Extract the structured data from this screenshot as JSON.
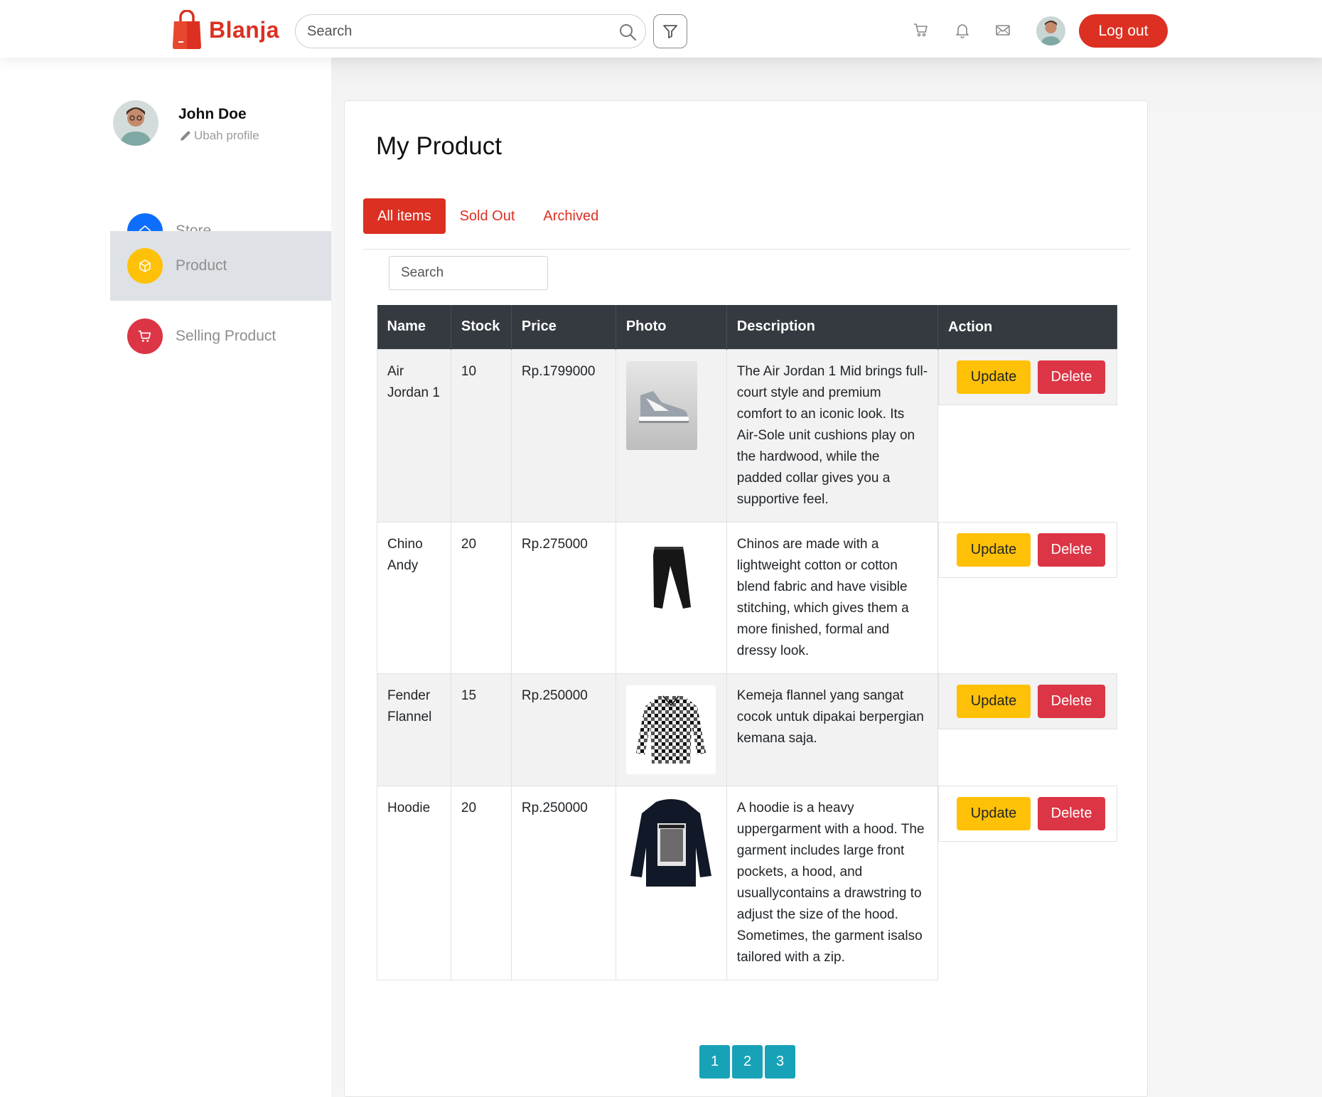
{
  "header": {
    "brand": "Blanja",
    "search_placeholder": "Search",
    "logout_label": "Log out"
  },
  "icons": {
    "search": "search-icon",
    "filter": "filter-icon",
    "cart": "cart-icon",
    "notifications": "bell-icon",
    "messages": "mail-icon"
  },
  "colors": {
    "brand": "#DB3022",
    "update": "#FFC107",
    "delete": "#DC3545",
    "pagination": "#17a2b8",
    "table_header": "#343a40",
    "store_icon_bg": "#0d6efd",
    "product_icon_bg": "#FFC107",
    "selling_icon_bg": "#DC3545"
  },
  "sidebar": {
    "name": "John Doe",
    "edit_label": "Ubah profile",
    "items": [
      {
        "label": "Store",
        "icon": "home-icon"
      },
      {
        "label": "Product",
        "icon": "box-icon",
        "active": true
      },
      {
        "label": "Selling Product",
        "icon": "cart-icon"
      }
    ]
  },
  "main": {
    "title": "My Product",
    "tabs": [
      {
        "label": "All items",
        "active": true
      },
      {
        "label": "Sold Out"
      },
      {
        "label": "Archived"
      }
    ],
    "search_placeholder": "Search",
    "table": {
      "columns": [
        "Name",
        "Stock",
        "Price",
        "Photo",
        "Description",
        "Action"
      ],
      "rows": [
        {
          "name": "Air Jordan 1",
          "stock": "10",
          "price": "Rp.1799000",
          "photo": "sneaker-photo",
          "description": "The Air Jordan 1 Mid brings full-court style and premium comfort to an iconic look. Its Air-Sole unit cushions play on the hardwood, while the padded collar gives you a supportive feel."
        },
        {
          "name": "Chino Andy",
          "stock": "20",
          "price": "Rp.275000",
          "photo": "pants-photo",
          "description": "Chinos are made with a lightweight cotton or cotton blend fabric and have visible stitching, which gives them a more finished, formal and dressy look."
        },
        {
          "name": "Fender Flannel",
          "stock": "15",
          "price": "Rp.250000",
          "photo": "flannel-photo",
          "description": "Kemeja flannel yang sangat cocok untuk dipakai berpergian kemana saja."
        },
        {
          "name": "Hoodie",
          "stock": "20",
          "price": "Rp.250000",
          "photo": "hoodie-photo",
          "description": "A hoodie is a heavy uppergarment with a hood. The garment includes large front pockets, a hood, and usuallycontains a drawstring to adjust the size of the hood. Sometimes, the garment isalso tailored with a zip."
        }
      ],
      "update_label": "Update",
      "delete_label": "Delete"
    },
    "pagination": [
      "1",
      "2",
      "3"
    ]
  }
}
